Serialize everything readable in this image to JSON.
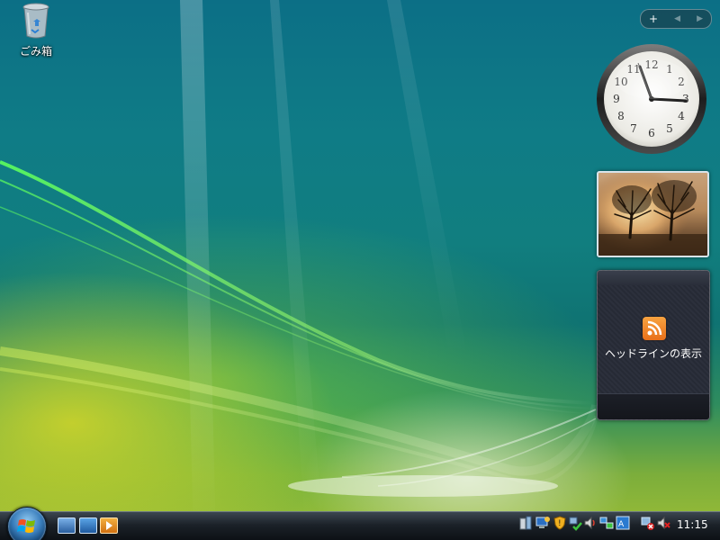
{
  "desktop": {
    "icons": [
      {
        "label": "ごみ箱",
        "icon": "recycle-bin-icon"
      }
    ]
  },
  "sidebar": {
    "controls": {
      "add": "+",
      "prev": "◀",
      "next": "▶"
    },
    "clock_gadget": {
      "numerals": [
        "12",
        "1",
        "2",
        "3",
        "4",
        "5",
        "6",
        "7",
        "8",
        "9",
        "10",
        "11"
      ]
    },
    "slideshow_gadget": {
      "image": "tree-sunset-photo"
    },
    "feed_gadget": {
      "icon": "rss-icon",
      "label": "ヘッドラインの表示"
    }
  },
  "taskbar": {
    "start_button": "windows-start-orb",
    "quick_launch": [
      "switch-windows-icon",
      "show-desktop-icon",
      "media-player-icon"
    ],
    "tray_icons": [
      "network-file-icon",
      "computer-icon",
      "security-shield-icon",
      "network-check-icon",
      "volume-icon",
      "network-status-icon",
      "language-bar-icon",
      "network-disconnected-icon",
      "muted-speaker-icon"
    ],
    "clock_time": "11:15"
  },
  "colors": {
    "accent": "#0f7c86",
    "rss": "#f08a2a"
  }
}
